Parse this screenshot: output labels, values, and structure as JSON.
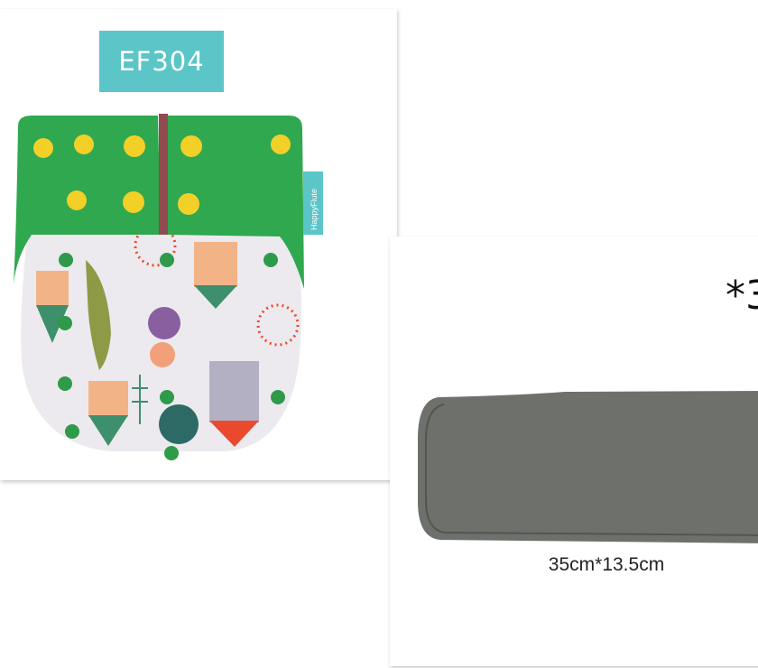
{
  "product": {
    "code": "EF304",
    "brand_tag": "HappyFlute",
    "quantity_label": "*3",
    "insert_size": "35cm*13.5cm"
  },
  "colors": {
    "label_bg": "#5bc5c8",
    "waistband": "#2fa84f",
    "snap_yellow": "#f2d028",
    "snap_green": "#2f9a4a",
    "print_bg": "#eceaee",
    "insert_gray": "#6e706c"
  }
}
